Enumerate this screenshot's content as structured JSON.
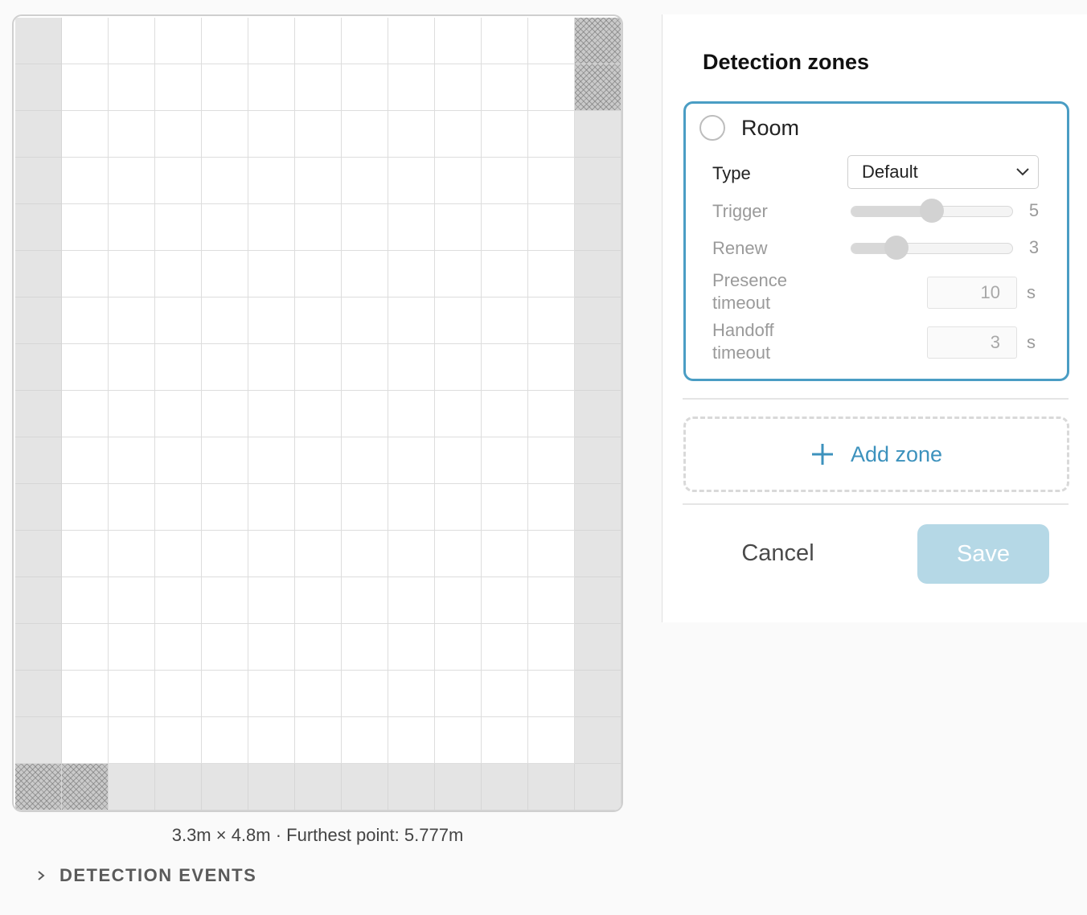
{
  "grid": {
    "columns": 13,
    "rows": 17,
    "blocked_cells": [
      [
        0,
        12
      ],
      [
        1,
        12
      ],
      [
        16,
        0
      ],
      [
        16,
        1
      ]
    ],
    "edge_columns": [
      0,
      12
    ],
    "edge_rows": [
      16
    ]
  },
  "dimensions_text": "3.3m × 4.8m · Furthest point: 5.777m",
  "detection_events": {
    "label": "DETECTION EVENTS",
    "expanded": false
  },
  "panel": {
    "title": "Detection zones",
    "zone": {
      "name": "Room",
      "selected": false,
      "type_label": "Type",
      "type_value": "Default",
      "trigger": {
        "label": "Trigger",
        "value": 5,
        "fraction": 0.5,
        "value_text": "5"
      },
      "renew": {
        "label": "Renew",
        "value": 3,
        "fraction": 0.28,
        "value_text": "3"
      },
      "presence_timeout": {
        "label_line1": "Presence",
        "label_line2": "timeout",
        "value": "10",
        "unit": "s"
      },
      "handoff_timeout": {
        "label_line1": "Handoff",
        "label_line2": "timeout",
        "value": "3",
        "unit": "s"
      }
    },
    "add_zone_label": "Add zone",
    "cancel_label": "Cancel",
    "save_label": "Save"
  },
  "icons": {
    "radio": "radio-unchecked-icon",
    "select_caret": "chevron-down-icon",
    "add": "plus-icon",
    "expand": "chevron-right-icon"
  },
  "colors": {
    "accent": "#4a9dc4",
    "accent_text": "#3d92bd",
    "save_disabled": "#b5d8e6",
    "edge_cell": "#e4e4e4",
    "blocked_cell": "#c9c9c9"
  }
}
